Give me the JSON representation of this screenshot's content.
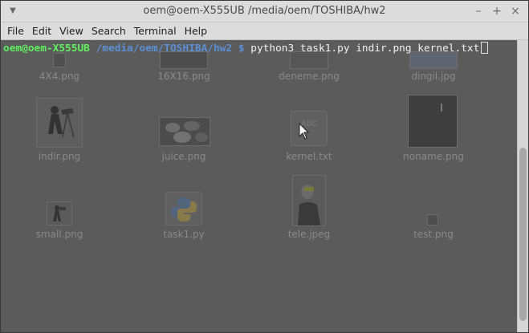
{
  "window": {
    "title": "oem@oem-X555UB /media/oem/TOSHIBA/hw2",
    "menu_icon": "chevron-down-icon",
    "min_icon": "minimize-icon",
    "max_icon": "maximize-icon",
    "close_icon": "close-icon"
  },
  "menubar": {
    "items": [
      "File",
      "Edit",
      "View",
      "Search",
      "Terminal",
      "Help"
    ]
  },
  "terminal": {
    "user_host": "oem@oem-X555UB",
    "path": "/media/oem/TOSHIBA/hw2",
    "prompt_symbol": "$",
    "command": "python3 task1.py indir.png kernel.txt"
  },
  "files": [
    {
      "name": "4X4.png"
    },
    {
      "name": "16X16.png"
    },
    {
      "name": "deneme.png"
    },
    {
      "name": "dingil.jpg"
    },
    {
      "name": "indir.png"
    },
    {
      "name": "juice.png"
    },
    {
      "name": "kernel.txt"
    },
    {
      "name": "noname.png"
    },
    {
      "name": "small.png"
    },
    {
      "name": "task1.py"
    },
    {
      "name": "tele.jpeg"
    },
    {
      "name": "test.png"
    }
  ],
  "kernel_icon_text": "ABC",
  "colors": {
    "prompt_user": "#5ff05f",
    "prompt_path": "#5b8fd6",
    "terminal_bg": "#5b5b5b"
  }
}
